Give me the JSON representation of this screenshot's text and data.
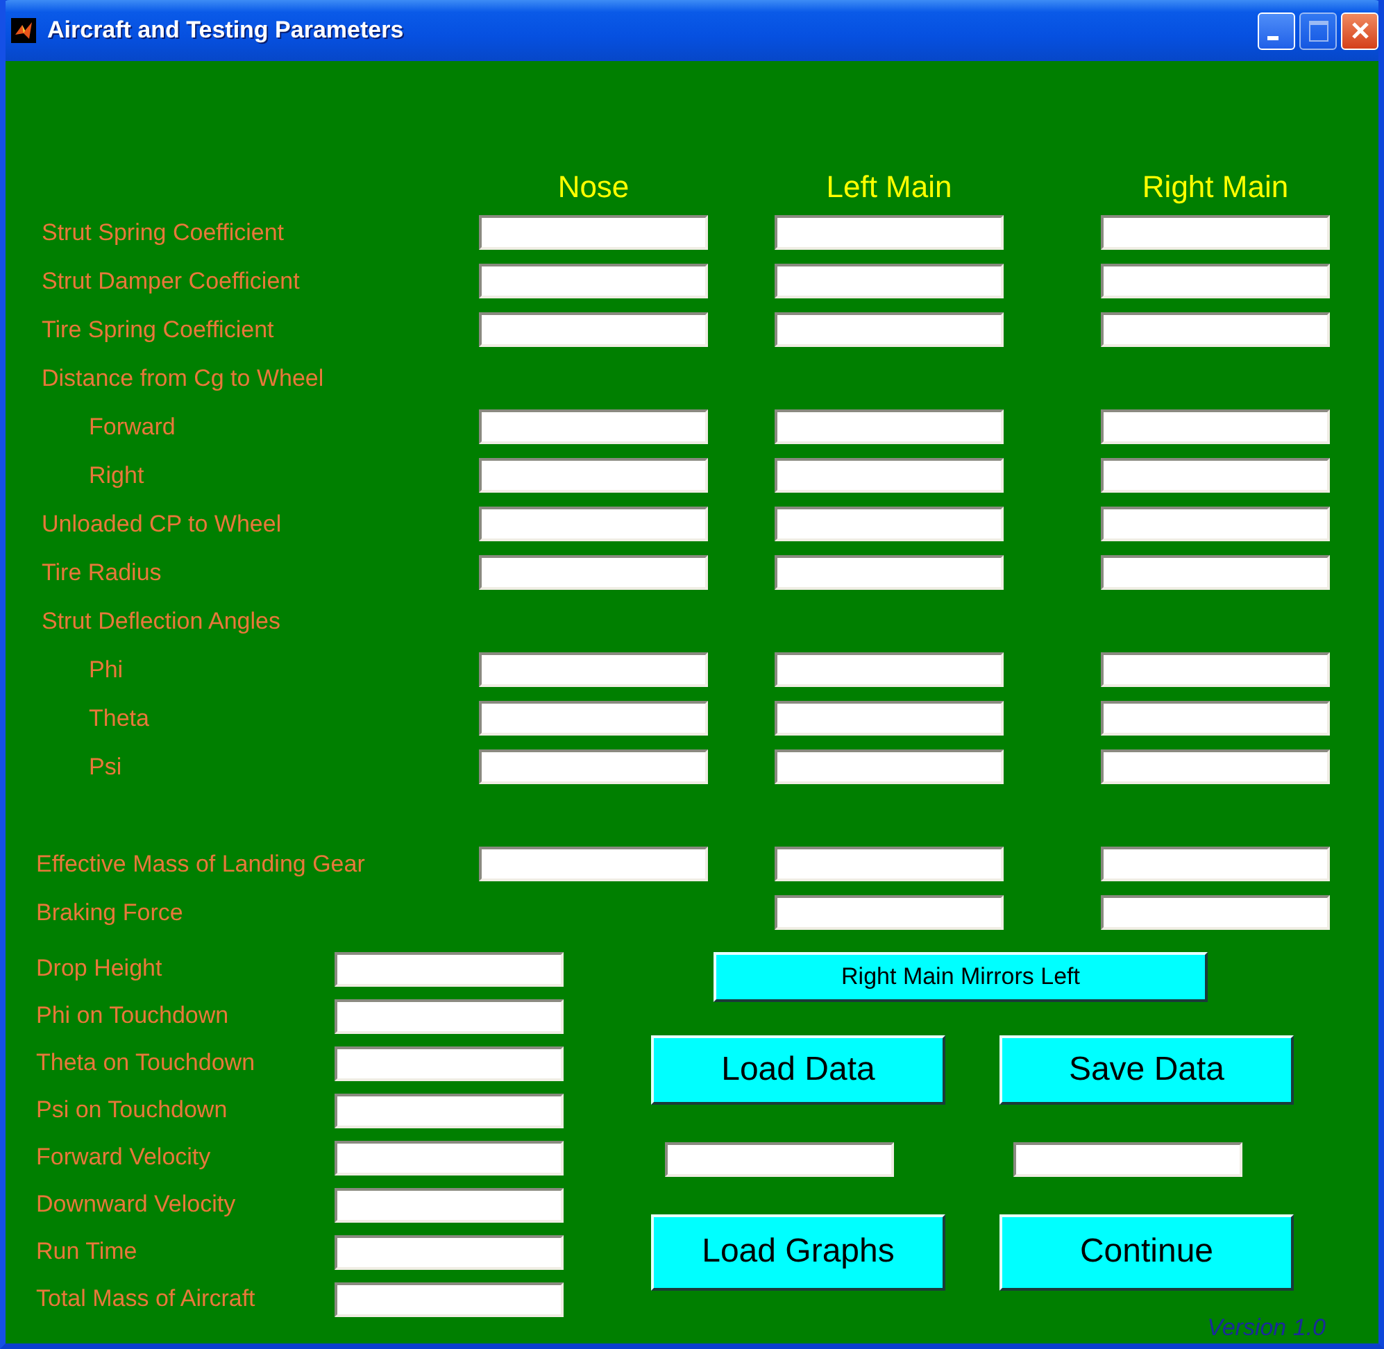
{
  "window": {
    "title": "Aircraft and Testing Parameters"
  },
  "columns": [
    "Nose",
    "Left Main",
    "Right Main"
  ],
  "parameters": [
    {
      "label": "Strut Spring Coefficient",
      "kind": "all"
    },
    {
      "label": "Strut Damper Coefficient",
      "kind": "all"
    },
    {
      "label": "Tire Spring Coefficient",
      "kind": "all"
    },
    {
      "label": "Distance from Cg to Wheel",
      "kind": "heading",
      "children": [
        {
          "label": "Forward",
          "kind": "all"
        },
        {
          "label": "Right",
          "kind": "all"
        }
      ]
    },
    {
      "label": "Unloaded CP to Wheel",
      "kind": "all"
    },
    {
      "label": "Tire Radius",
      "kind": "all"
    },
    {
      "label": "Strut Deflection Angles",
      "kind": "heading",
      "children": [
        {
          "label": "Phi",
          "kind": "all"
        },
        {
          "label": "Theta",
          "kind": "all"
        },
        {
          "label": "Psi",
          "kind": "all"
        }
      ]
    }
  ],
  "gear_loads": [
    {
      "label": "Effective Mass of Landing Gear",
      "kind": "all"
    },
    {
      "label": "Braking Force",
      "kind": "mains"
    }
  ],
  "test_conditions": [
    "Drop Height",
    "Phi on Touchdown",
    "Theta on Touchdown",
    "Psi on Touchdown",
    "Forward Velocity",
    "Downward Velocity",
    "Run Time",
    "Total Mass of Aircraft"
  ],
  "mirror_button": "Right Main Mirrors Left",
  "actions": [
    {
      "label": "Load Data",
      "kind": "button"
    },
    {
      "label": "Save Data",
      "kind": "button"
    },
    {
      "kind": "field"
    },
    {
      "kind": "field"
    },
    {
      "label": "Load Graphs",
      "kind": "button"
    },
    {
      "label": "Continue",
      "kind": "button"
    }
  ],
  "version": "Version 1.0"
}
